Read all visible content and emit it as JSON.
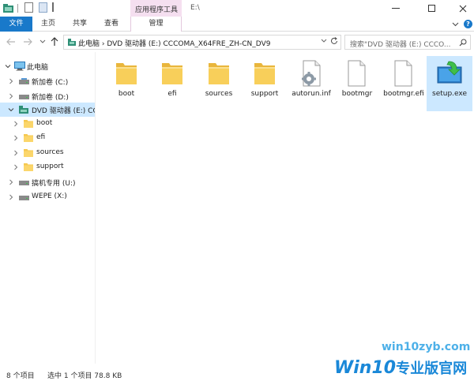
{
  "window": {
    "title": "E:\\",
    "context_tab_header": "应用程序工具"
  },
  "ribbon": {
    "tabs": [
      {
        "label": "文件"
      },
      {
        "label": "主页"
      },
      {
        "label": "共享"
      },
      {
        "label": "查看"
      },
      {
        "label": "管理"
      }
    ],
    "help": "?"
  },
  "address": {
    "path": "此电脑 › DVD 驱动器 (E:) CCCOMA_X64FRE_ZH-CN_DV9",
    "search_placeholder": "搜索\"DVD 驱动器 (E:) CCCO..."
  },
  "tree": [
    {
      "label": "此电脑",
      "icon": "computer-icon"
    },
    {
      "label": "新加卷 (C:)",
      "icon": "drive-icon"
    },
    {
      "label": "新加卷 (D:)",
      "icon": "drive-icon"
    },
    {
      "label": "DVD 驱动器 (E:) CC",
      "icon": "dvd-drive-icon"
    },
    {
      "label": "boot",
      "icon": "folder-icon"
    },
    {
      "label": "efi",
      "icon": "folder-icon"
    },
    {
      "label": "sources",
      "icon": "folder-icon"
    },
    {
      "label": "support",
      "icon": "folder-icon"
    },
    {
      "label": "搞机专用 (U:)",
      "icon": "drive-icon"
    },
    {
      "label": "WEPE (X:)",
      "icon": "drive-icon"
    }
  ],
  "files": [
    {
      "label": "boot",
      "icon": "folder-icon"
    },
    {
      "label": "efi",
      "icon": "folder-icon"
    },
    {
      "label": "sources",
      "icon": "folder-icon"
    },
    {
      "label": "support",
      "icon": "folder-icon"
    },
    {
      "label": "autorun.inf",
      "icon": "settings-file-icon"
    },
    {
      "label": "bootmgr",
      "icon": "file-icon"
    },
    {
      "label": "bootmgr.efi",
      "icon": "file-icon"
    },
    {
      "label": "setup.exe",
      "icon": "setup-icon"
    }
  ],
  "status": {
    "item_count": "8 个项目",
    "selection": "选中 1 个项目  78.8 KB"
  },
  "watermark": {
    "site": "win10zyb.com",
    "brand_main": "Win10",
    "brand_sub": "专业版官网"
  },
  "colors": {
    "accent": "#1979ca",
    "selection": "#cce8ff",
    "context_tab": "#f5dff0",
    "folder": "#f5c84f"
  }
}
